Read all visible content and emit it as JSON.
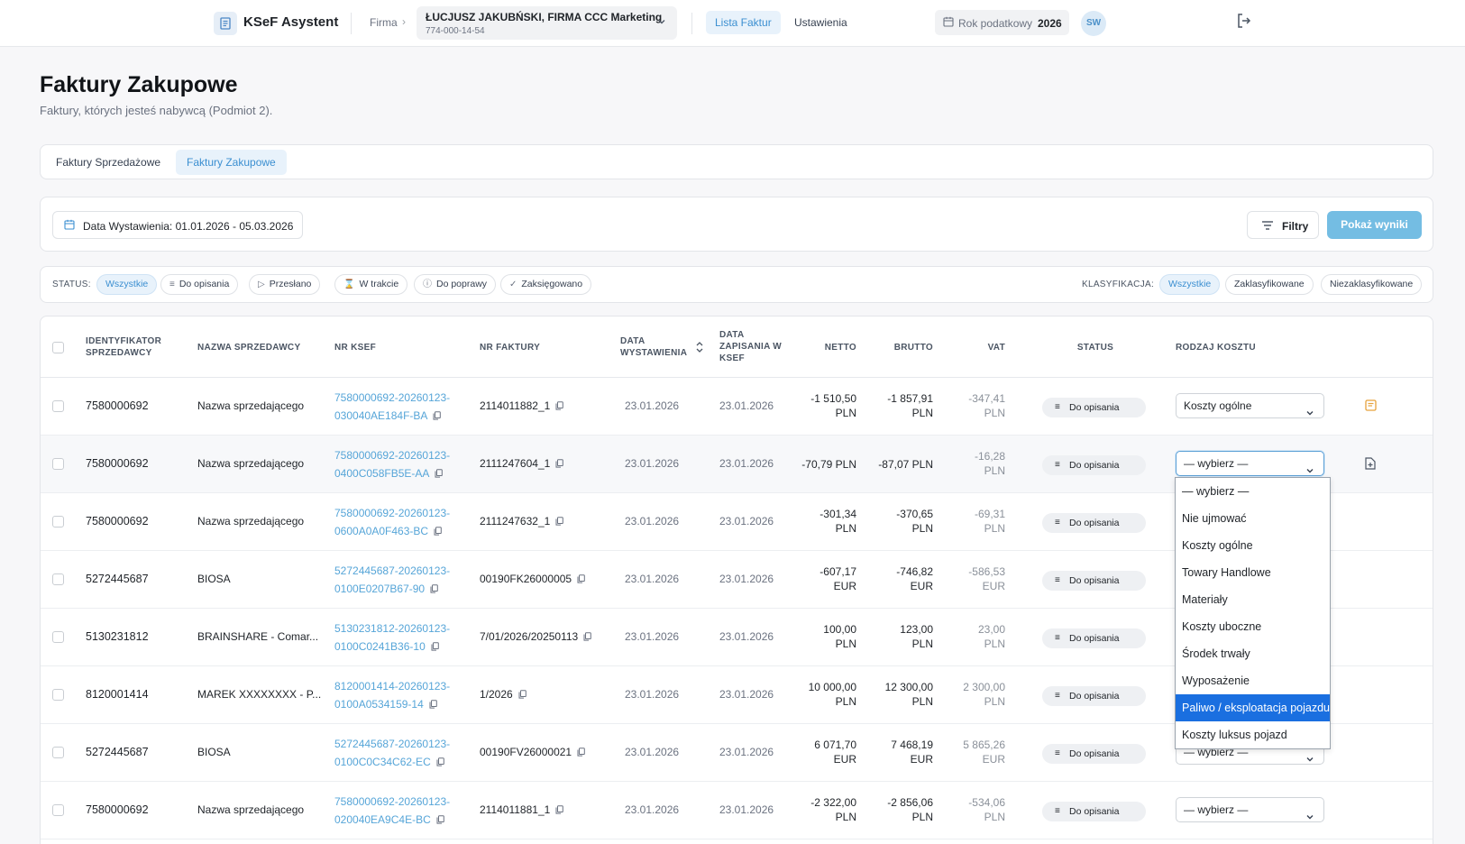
{
  "app": {
    "title": "KSeF Asystent",
    "firma_label": "Firma",
    "company_name": "ŁUCJUSZ JAKUBŃSKI, FIRMA CCC Marketing",
    "company_nip": "774-000-14-54",
    "nav": [
      "Lista Faktur",
      "Ustawienia"
    ],
    "year_label": "Rok podatkowy",
    "year_value": "2026",
    "avatar": "SW",
    "accent": "#3b8fd1"
  },
  "page": {
    "title": "Faktury Zakupowe",
    "subtitle": "Faktury, których jesteś nabywcą (Podmiot 2)."
  },
  "tabs": [
    "Faktury Sprzedażowe",
    "Faktury Zakupowe"
  ],
  "filters": {
    "date_label": "Data Wystawienia: 01.01.2026 - 05.03.2026",
    "filter_button": "Filtry",
    "show_button": "Pokaż wyniki"
  },
  "status_filter": {
    "label": "STATUS:",
    "chips": [
      "Wszystkie",
      "Do opisania",
      "Przesłano",
      "W trakcie",
      "Do poprawy",
      "Zaksięgowano"
    ],
    "class_label": "KLASYFIKACJA:",
    "class_chips": [
      "Wszystkie",
      "Zaklasyfikowane",
      "Niezaklasyfikowane"
    ]
  },
  "table": {
    "headers": {
      "id": "IDENTYFIKATOR SPRZEDAWCY",
      "seller": "NAZWA SPRZEDAWCY",
      "ksef": "NR KSEF",
      "invoice": "NR FAKTURY",
      "issue_date": "DATA WYSTAWIENIA",
      "saved_date": "DATA ZAPISANIA W KSEF",
      "net": "NETTO",
      "gross": "BRUTTO",
      "vat": "VAT",
      "status": "STATUS",
      "cost": "RODZAJ KOSZTU"
    },
    "rows": [
      {
        "id": "7580000692",
        "seller": "Nazwa sprzedającego",
        "ksef1": "7580000692-20260123-",
        "ksef2": "030040AE184F-BA",
        "invoice": "2114011882_1",
        "issue": "23.01.2026",
        "saved": "23.01.2026",
        "net1": "-1 510,50",
        "net2": "PLN",
        "gross1": "-1 857,91",
        "gross2": "PLN",
        "vat1": "-347,41",
        "vat2": "PLN",
        "status": "Do opisania",
        "cost": "Koszty ogólne"
      },
      {
        "id": "7580000692",
        "seller": "Nazwa sprzedającego",
        "ksef1": "7580000692-20260123-",
        "ksef2": "0400C058FB5E-AA",
        "invoice": "2111247604_1",
        "issue": "23.01.2026",
        "saved": "23.01.2026",
        "net1": "-70,79 PLN",
        "net2": "",
        "gross1": "-87,07 PLN",
        "gross2": "",
        "vat1": "-16,28",
        "vat2": "PLN",
        "status": "Do opisania",
        "cost": "— wybierz —"
      },
      {
        "id": "7580000692",
        "seller": "Nazwa sprzedającego",
        "ksef1": "7580000692-20260123-",
        "ksef2": "0600A0A0F463-BC",
        "invoice": "2111247632_1",
        "issue": "23.01.2026",
        "saved": "23.01.2026",
        "net1": "-301,34",
        "net2": "PLN",
        "gross1": "-370,65",
        "gross2": "PLN",
        "vat1": "-69,31",
        "vat2": "PLN",
        "status": "Do opisania",
        "cost": ""
      },
      {
        "id": "5272445687",
        "seller": "BIOSA",
        "ksef1": "5272445687-20260123-",
        "ksef2": "0100E0207B67-90",
        "invoice": "00190FK26000005",
        "issue": "23.01.2026",
        "saved": "23.01.2026",
        "net1": "-607,17",
        "net2": "EUR",
        "gross1": "-746,82",
        "gross2": "EUR",
        "vat1": "-586,53",
        "vat2": "EUR",
        "status": "Do opisania",
        "cost": ""
      },
      {
        "id": "5130231812",
        "seller": "BRAINSHARE - Comar...",
        "ksef1": "5130231812-20260123-",
        "ksef2": "0100C0241B36-10",
        "invoice": "7/01/2026/20250113",
        "issue": "23.01.2026",
        "saved": "23.01.2026",
        "net1": "100,00",
        "net2": "PLN",
        "gross1": "123,00",
        "gross2": "PLN",
        "vat1": "23,00",
        "vat2": "PLN",
        "status": "Do opisania",
        "cost": ""
      },
      {
        "id": "8120001414",
        "seller": "MAREK XXXXXXXX - P...",
        "ksef1": "8120001414-20260123-",
        "ksef2": "0100A0534159-14",
        "invoice": "1/2026",
        "issue": "23.01.2026",
        "saved": "23.01.2026",
        "net1": "10 000,00",
        "net2": "PLN",
        "gross1": "12 300,00",
        "gross2": "PLN",
        "vat1": "2 300,00",
        "vat2": "PLN",
        "status": "Do opisania",
        "cost": ""
      },
      {
        "id": "5272445687",
        "seller": "BIOSA",
        "ksef1": "5272445687-20260123-",
        "ksef2": "0100C0C34C62-EC",
        "invoice": "00190FV26000021",
        "issue": "23.01.2026",
        "saved": "23.01.2026",
        "net1": "6 071,70",
        "net2": "EUR",
        "gross1": "7 468,19",
        "gross2": "EUR",
        "vat1": "5 865,26",
        "vat2": "EUR",
        "status": "Do opisania",
        "cost": "— wybierz —"
      },
      {
        "id": "7580000692",
        "seller": "Nazwa sprzedającego",
        "ksef1": "7580000692-20260123-",
        "ksef2": "020040EA9C4E-BC",
        "invoice": "2114011881_1",
        "issue": "23.01.2026",
        "saved": "23.01.2026",
        "net1": "-2 322,00",
        "net2": "PLN",
        "gross1": "-2 856,06",
        "gross2": "PLN",
        "vat1": "-534,06",
        "vat2": "PLN",
        "status": "Do opisania",
        "cost": "— wybierz —"
      }
    ]
  },
  "dropdown": {
    "options": [
      "— wybierz —",
      "Nie ujmować",
      "Koszty ogólne",
      "Towary Handlowe",
      "Materiały",
      "Koszty uboczne",
      "Środek trwały",
      "Wyposażenie",
      "Paliwo / eksploatacja pojazdu",
      "Koszty luksus pojazd"
    ],
    "highlighted": "Paliwo / eksploatacja pojazdu",
    "highlight_color": "#1a6fe0"
  }
}
